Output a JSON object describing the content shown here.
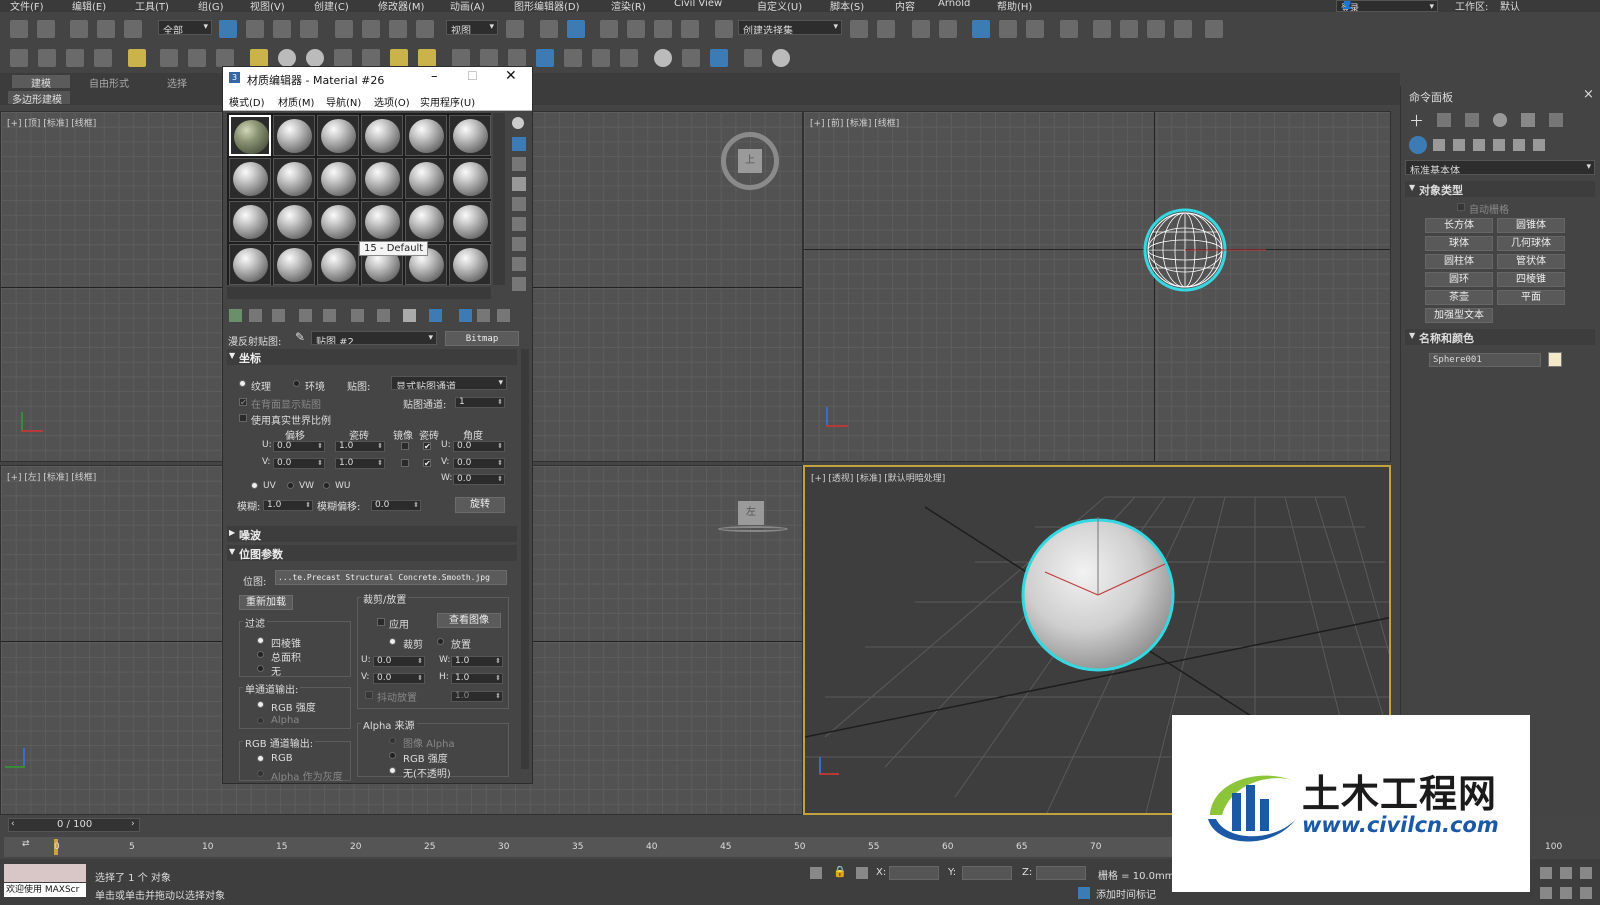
{
  "menubar": {
    "items": [
      "文件(F)",
      "编辑(E)",
      "工具(T)",
      "组(G)",
      "视图(V)",
      "创建(C)",
      "修改器(M)",
      "动画(A)",
      "图形编辑器(D)",
      "渲染(R)",
      "Civil View",
      "自定义(U)",
      "脚本(S)",
      "内容",
      "Arnold",
      "帮助(H)"
    ],
    "login": "登录",
    "workspace_label": "工作区:",
    "workspace_value": "默认"
  },
  "toolbar": {
    "filter": "全部",
    "ref_coord": "视图",
    "selection_set": "创建选择集"
  },
  "ribbon": {
    "tabs": [
      "建模",
      "自由形式",
      "选择"
    ],
    "subtitle": "多边形建模"
  },
  "viewports": {
    "top": "[+] [顶] [标准] [线框]",
    "front": "[+] [前] [标准] [线框]",
    "left": "[+] [左] [标准] [线框]",
    "persp": "[+] [透视] [标准] [默认明暗处理]",
    "viewcube_top": "上",
    "viewcube_left": "左"
  },
  "material_editor": {
    "title": "材质编辑器 - Material #26",
    "menu": [
      "模式(D)",
      "材质(M)",
      "导航(N)",
      "选项(O)",
      "实用程序(U)"
    ],
    "tooltip": "15 - Default",
    "diffuse_label": "漫反射贴图:",
    "map_name": "贴图 #2",
    "map_type": "Bitmap",
    "coords": {
      "header": "坐标",
      "texture": "纹理",
      "environ": "环境",
      "mapping_label": "贴图:",
      "mapping_value": "显式贴图通道",
      "show_back": "在背面显示贴图",
      "channel_label": "贴图通道:",
      "channel_value": "1",
      "real_world": "使用真实世界比例",
      "col_offset": "偏移",
      "col_tiling": "瓷砖",
      "col_mirror": "镜像",
      "col_tile": "瓷砖",
      "col_angle": "角度",
      "u_label": "U:",
      "v_label": "V:",
      "w_label": "W:",
      "u_offset": "0.0",
      "v_offset": "0.0",
      "u_tiling": "1.0",
      "v_tiling": "1.0",
      "u_angle": "0.0",
      "v_angle": "0.0",
      "w_angle": "0.0",
      "uv": "UV",
      "vw": "VW",
      "wu": "WU",
      "blur_label": "模糊:",
      "blur_value": "1.0",
      "blur_offset_label": "模糊偏移:",
      "blur_offset_value": "0.0",
      "rotate": "旋转",
      "check": "✔"
    },
    "noise_header": "噪波",
    "bitmap_params": {
      "header": "位图参数",
      "bitmap_label": "位图:",
      "bitmap_path": "...te.Precast Structural Concrete.Smooth.jpg",
      "reload": "重新加载",
      "crop_group": "裁剪/放置",
      "apply": "应用",
      "view_image": "查看图像",
      "crop": "裁剪",
      "place": "放置",
      "u_label": "U:",
      "v_label": "V:",
      "w_label": "W:",
      "h_label": "H:",
      "u_value": "0.0",
      "v_value": "0.0",
      "w_value": "1.0",
      "h_value": "1.0",
      "jitter": "抖动放置",
      "jitter_value": "1.0",
      "filter_group": "过滤",
      "filter_pyramid": "四棱锥",
      "filter_sat": "总面积",
      "filter_none": "无",
      "mono_group": "单通道输出:",
      "mono_rgb": "RGB 强度",
      "mono_alpha": "Alpha",
      "rgb_group": "RGB 通道输出:",
      "rgb_rgb": "RGB",
      "rgb_alpha": "Alpha 作为灰度",
      "alpha_group": "Alpha 来源",
      "alpha_image": "图像 Alpha",
      "alpha_rgb": "RGB 强度",
      "alpha_none": "无(不透明)"
    }
  },
  "command_panel": {
    "title": "命令面板",
    "close": "×",
    "category": "标准基本体",
    "obj_type_header": "对象类型",
    "autogrid": "自动栅格",
    "buttons": [
      "长方体",
      "圆锥体",
      "球体",
      "几何球体",
      "圆柱体",
      "管状体",
      "圆环",
      "四棱锥",
      "茶壶",
      "平面",
      "加强型文本"
    ],
    "name_color_header": "名称和颜色",
    "object_name": "Sphere001",
    "object_color": "#f3e9c8"
  },
  "timeline": {
    "frame": "0 / 100",
    "ticks": [
      "0",
      "5",
      "10",
      "15",
      "20",
      "25",
      "30",
      "35",
      "40",
      "45",
      "50",
      "55",
      "60",
      "65",
      "70",
      "100"
    ]
  },
  "status": {
    "welcome": "欢迎使用 MAXScr",
    "selected": "选择了 1 个 对象",
    "prompt": "单击或单击并拖动以选择对象",
    "x_label": "X:",
    "y_label": "Y:",
    "z_label": "Z:",
    "grid": "栅格 = 10.0mm",
    "add_tag": "添加时间标记"
  },
  "watermark": {
    "name": "土木工程网",
    "url": "www.civilcn.com"
  }
}
